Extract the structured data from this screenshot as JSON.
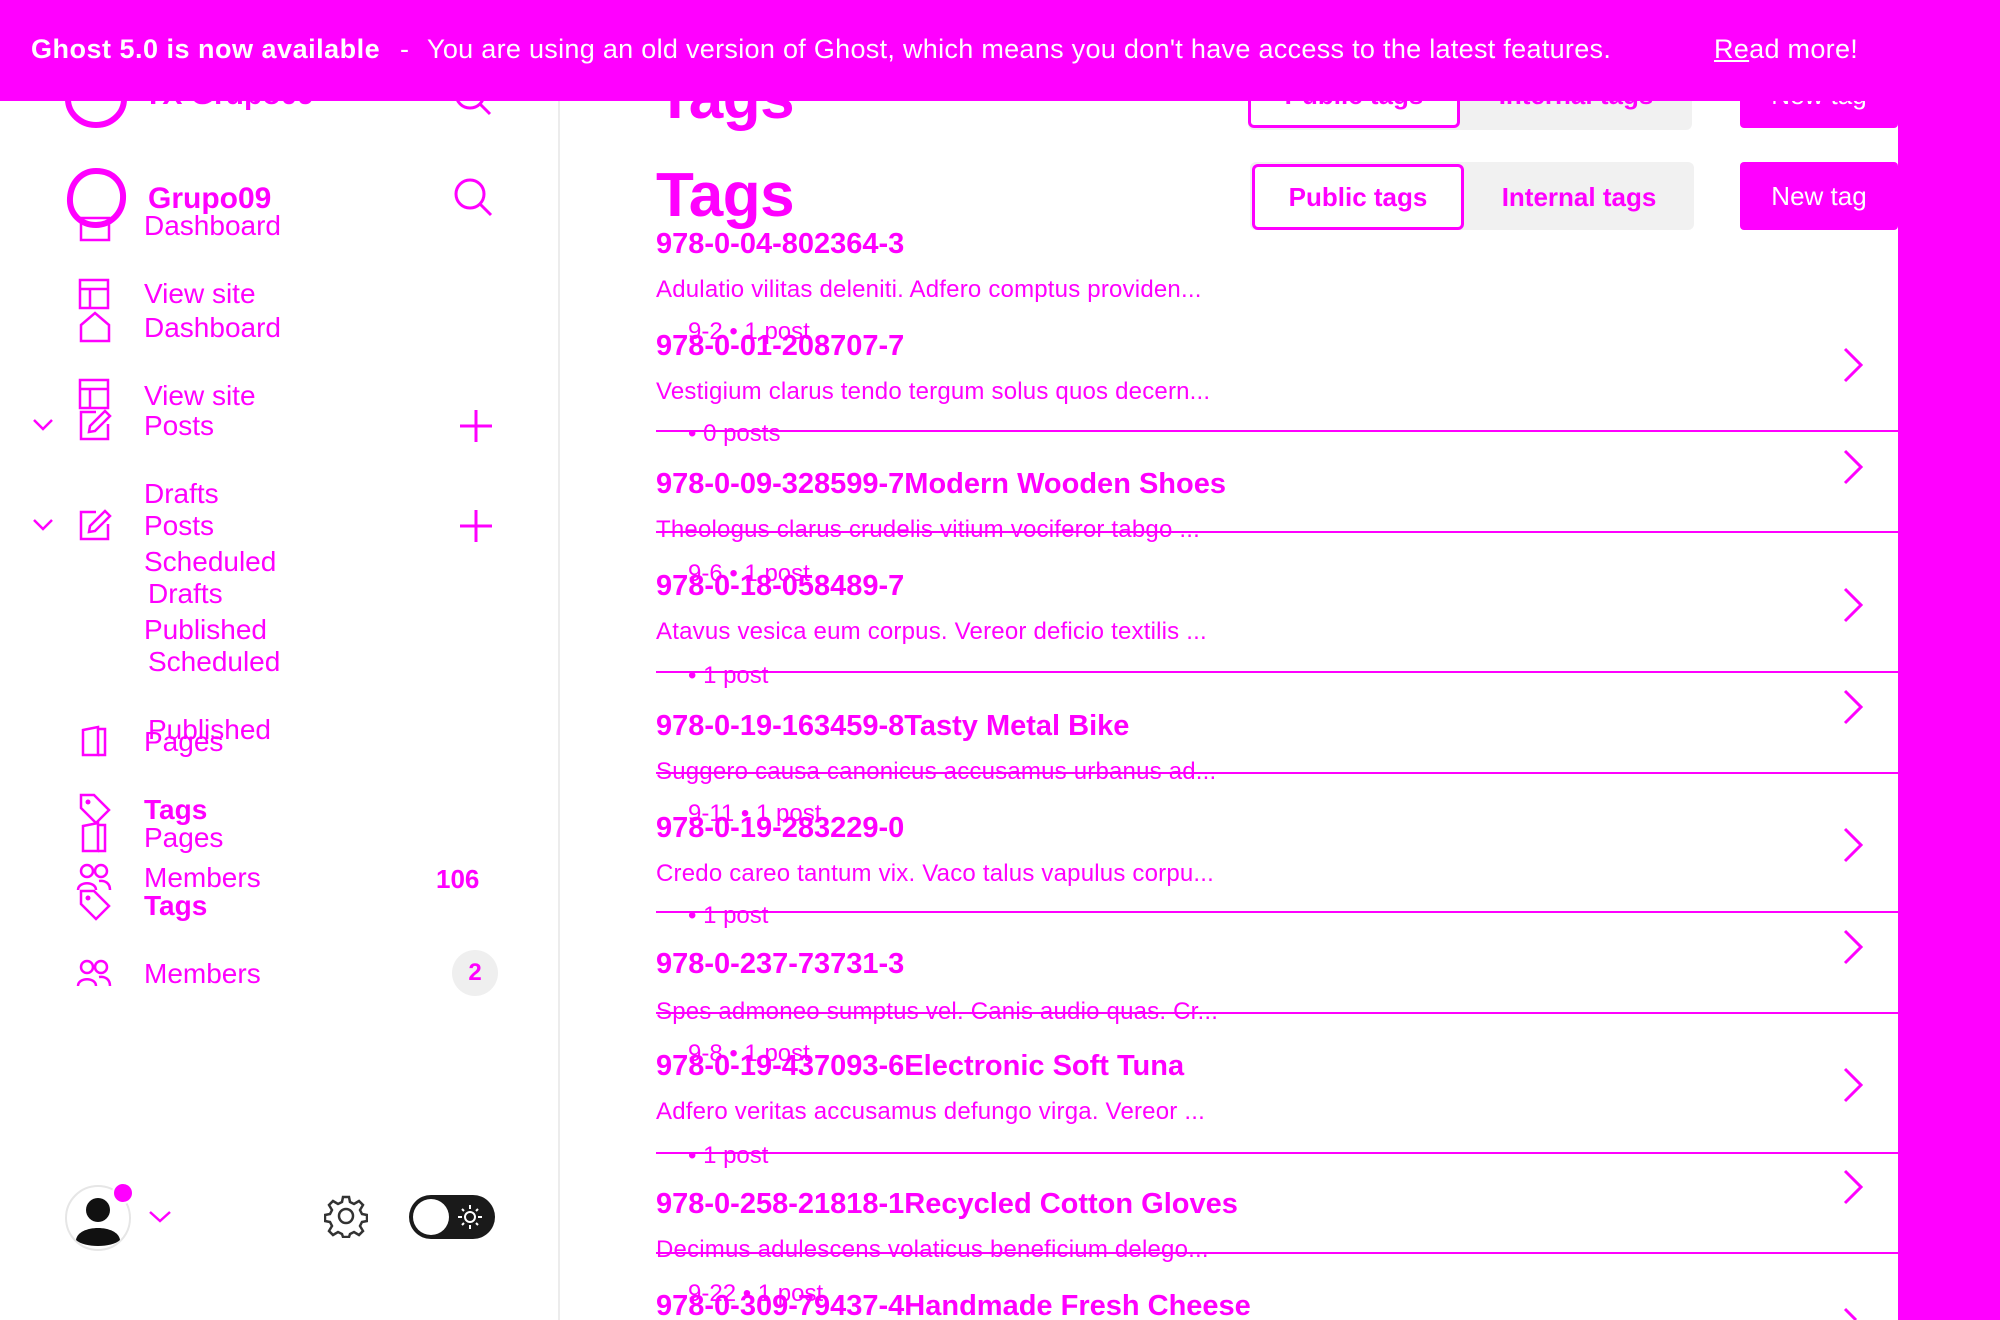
{
  "banner": {
    "title": "Ghost 5.0 is now available",
    "separator": "-",
    "message": "You are using an old version of Ghost, which means you don't have access to the latest features.",
    "link_first": "Re",
    "link_rest": "ad more!"
  },
  "sidebar": {
    "site_name_ghost": "TX Grupo09",
    "site_name": "Grupo09",
    "ghost_items": [
      "Dashboard",
      "View site",
      "Posts",
      "Drafts",
      "Scheduled",
      "Published",
      "Pages",
      "Tags",
      "Members"
    ],
    "ghost_members_count": "106",
    "items": [
      "Dashboard",
      "View site",
      "Posts",
      "Drafts",
      "Scheduled",
      "Published",
      "Pages",
      "Tags",
      "Members"
    ],
    "members_count": "2"
  },
  "main": {
    "title_ghost": "Tags",
    "title": "Tags",
    "tabs_ghost": [
      "Public tags",
      "Internal tags"
    ],
    "tabs": [
      "Public tags",
      "Internal tags"
    ],
    "new_tag_ghost": "New tag",
    "new_tag": "New tag"
  },
  "tags": [
    {
      "name": "978-0-04-802364-3",
      "desc": "Adulatio vilitas deleniti. Adfero comptus providen...",
      "meta": "9-2 • 1 post"
    },
    {
      "name": "978-0-01-208707-7",
      "desc": "Vestigium clarus tendo tergum solus quos decern...",
      "meta": "• 0 posts"
    },
    {
      "name": "978-0-09-328599-7Modern Wooden Shoes",
      "desc": "Theologus clarus crudelis vitium vociferor tabgo ...",
      "meta": "9-6 • 1 post"
    },
    {
      "name": "978-0-18-058489-7",
      "desc": "Atavus vesica eum corpus. Vereor deficio textilis ...",
      "meta": "• 1 post"
    },
    {
      "name": "978-0-19-163459-8Tasty Metal Bike",
      "desc": "Suggero causa canonicus accusamus urbanus ad...",
      "meta": "9-11 • 1 post"
    },
    {
      "name": "978-0-19-283229-0",
      "desc": "Credo careo tantum vix. Vaco talus vapulus corpu...",
      "meta": "• 1 post"
    },
    {
      "name": "978-0-237-73731-3",
      "desc": "Spes admoneo sumptus vel. Canis audio quas. Cr...",
      "meta": "9-8 • 1 post"
    },
    {
      "name": "978-0-19-437093-6Electronic Soft Tuna",
      "desc": "Adfero veritas accusamus defungo virga. Vereor ...",
      "meta": "• 1 post"
    },
    {
      "name": "978-0-258-21818-1Recycled Cotton Gloves",
      "desc": "Decimus adulescens volaticus beneficium delego...",
      "meta": "9-22 • 1 post"
    },
    {
      "name": "978-0-309-79437-4Handmade Fresh Cheese",
      "desc": "",
      "meta": ""
    }
  ],
  "colors": {
    "accent": "#ff00ff",
    "background": "#ffffff"
  }
}
